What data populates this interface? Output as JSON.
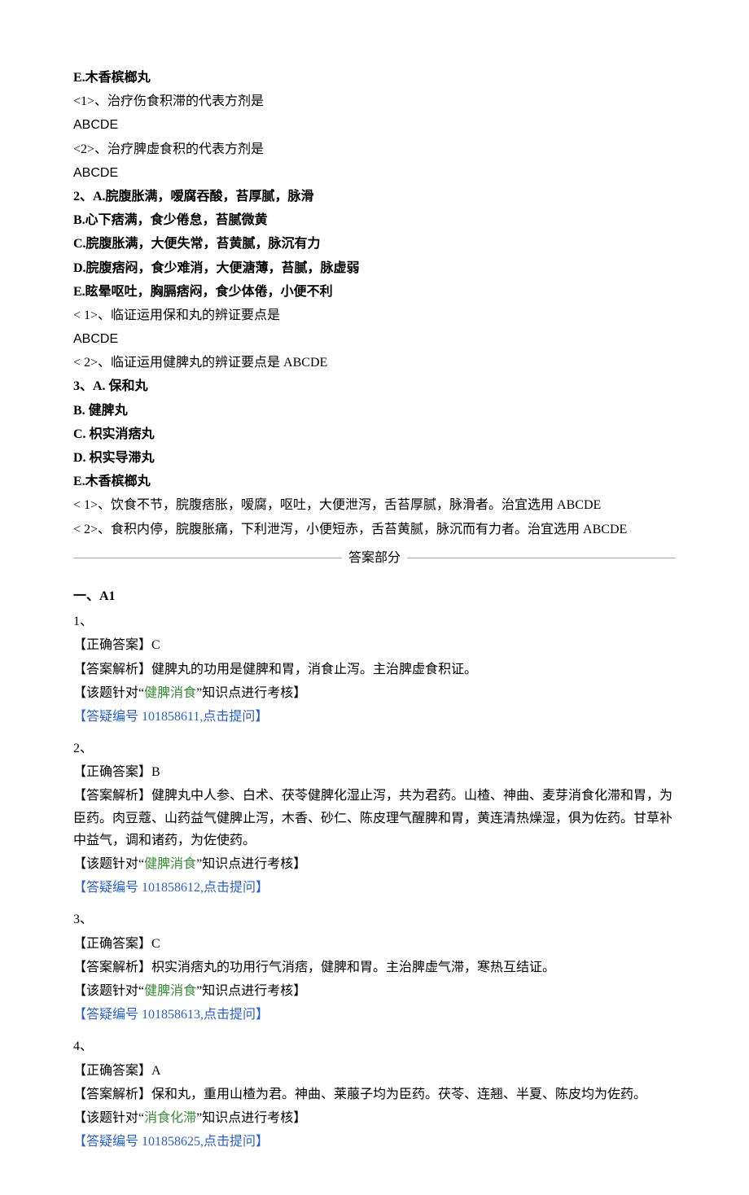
{
  "options1": {
    "E": "E.木香槟榔丸",
    "q1": "<1>、治疗伤食积滞的代表方剂是",
    "q1_choices": "ABCDE",
    "q2": "<2>、治疗脾虚食积的代表方剂是",
    "q2_choices": "ABCDE"
  },
  "q2block": {
    "A": "2、A.脘腹胀满，嗳腐吞酸，苔厚腻，脉滑",
    "B": "B.心下痞满，食少倦怠，苔腻微黄",
    "C": "C.脘腹胀满，大便失常，苔黄腻，脉沉有力",
    "D": "D.脘腹痞闷，食少难消，大便溏薄，苔腻，脉虚弱",
    "E": "E.眩晕呕吐，胸膈痞闷，食少体倦，小便不利",
    "sub1": "<   1>、临证运用保和丸的辨证要点是",
    "sub1_choices": "ABCDE",
    "sub2": "<   2>、临证运用健脾丸的辨证要点是 ABCDE"
  },
  "q3block": {
    "A": "3、A. 保和丸",
    "B": "B. 健脾丸",
    "C": "C. 枳实消痞丸",
    "D": "D. 枳实导滞丸",
    "E": "E.木香槟榔丸",
    "sub1": "<   1>、饮食不节，脘腹痞胀，嗳腐，呕吐，大便泄泻，舌苔厚腻，脉滑者。治宜选用 ABCDE",
    "sub2": "<   2>、食积内停，脘腹胀痛，下利泄泻，小便短赤，舌苔黄腻，脉沉而有力者。治宜选用 ABCDE"
  },
  "answer_header": "答案部分",
  "section_a1": "一、A1",
  "answers": [
    {
      "num": "1、",
      "correct_label": "【正确答案】",
      "correct": "C",
      "analysis_label": "【答案解析】",
      "analysis": "健脾丸的功用是健脾和胃，消食止泻。主治脾虚食积证。",
      "topic_pre": "【该题针对“",
      "topic": "健脾消食",
      "topic_post": "”知识点进行考核】",
      "qa_pre": "【答疑编号 ",
      "qa_id": "101858611",
      "qa_post": ",点击提问】"
    },
    {
      "num": "2、",
      "correct_label": "【正确答案】",
      "correct": "B",
      "analysis_label": "【答案解析】",
      "analysis": "健脾丸中人参、白术、茯苓健脾化湿止泻，共为君药。山楂、神曲、麦芽消食化滞和胃，为臣药。肉豆蔻、山药益气健脾止泻，木香、砂仁、陈皮理气醒脾和胃，黄连清热燥湿，俱为佐药。甘草补中益气，调和诸药，为佐使药。",
      "topic_pre": "【该题针对“",
      "topic": "健脾消食",
      "topic_post": "”知识点进行考核】",
      "qa_pre": "【答疑编号 ",
      "qa_id": "101858612",
      "qa_post": ",点击提问】"
    },
    {
      "num": "3、",
      "correct_label": "【正确答案】",
      "correct": "C",
      "analysis_label": "【答案解析】",
      "analysis": "枳实消痞丸的功用行气消痞，健脾和胃。主治脾虚气滞，寒热互结证。",
      "topic_pre": "【该题针对“",
      "topic": "健脾消食",
      "topic_post": "”知识点进行考核】",
      "qa_pre": "【答疑编号 ",
      "qa_id": "101858613",
      "qa_post": ",点击提问】"
    },
    {
      "num": "4、",
      "correct_label": "【正确答案】",
      "correct": "A",
      "analysis_label": "【答案解析】",
      "analysis": "保和丸，重用山楂为君。神曲、莱菔子均为臣药。茯苓、连翘、半夏、陈皮均为佐药。",
      "topic_pre": "【该题针对“",
      "topic": "消食化滞",
      "topic_post": "”知识点进行考核】",
      "qa_pre": "【答疑编号 ",
      "qa_id": "101858625",
      "qa_post": ",点击提问】"
    }
  ]
}
